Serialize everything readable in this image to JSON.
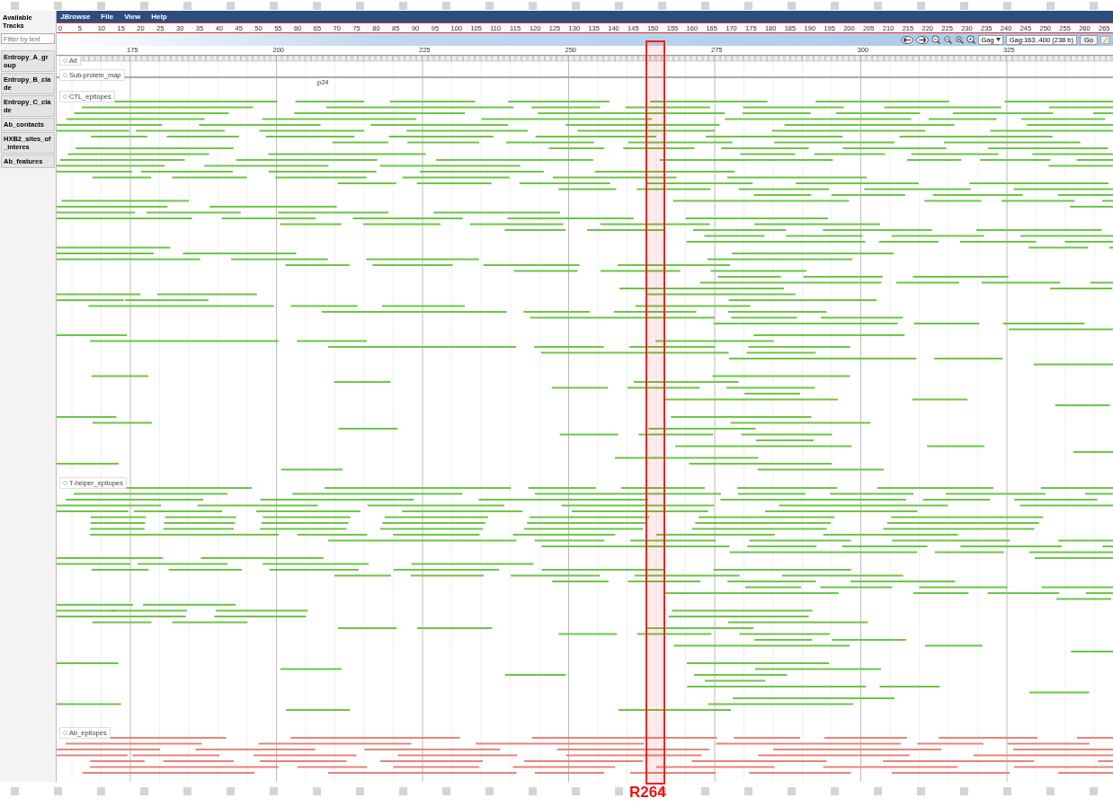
{
  "sidebar": {
    "title": "Available Tracks",
    "filter": {
      "placeholder": "Filter by text"
    },
    "tracks": [
      "Entropy_A_group",
      "Entropy_B_clade",
      "Entropy_C_clade",
      "Ab_contacts",
      "HXB2_sites_of_interes",
      "Ab_features"
    ]
  },
  "menu": {
    "logo": "JBrowse",
    "items": [
      "File",
      "View",
      "Help"
    ]
  },
  "overview_ruler": {
    "ticks": [
      "0",
      "5",
      "10",
      "15",
      "20",
      "25",
      "30",
      "35",
      "40",
      "45",
      "50",
      "55",
      "60",
      "65",
      "70",
      "75",
      "80",
      "85",
      "90",
      "95",
      "100",
      "105",
      "110",
      "115",
      "120",
      "125",
      "130",
      "135",
      "140",
      "145",
      "150",
      "155",
      "160",
      "165",
      "170",
      "175",
      "180",
      "185",
      "190",
      "195",
      "200",
      "205",
      "210",
      "215",
      "220",
      "225",
      "230",
      "235",
      "240",
      "245",
      "250",
      "255",
      "260",
      "265"
    ]
  },
  "navigation": {
    "reference": "Gag",
    "location": "Gag:163..400 (238 b)",
    "go": "Go"
  },
  "detail_ruler": {
    "ticks": [
      "175",
      "200",
      "225",
      "250",
      "275",
      "300",
      "325"
    ]
  },
  "tracks": [
    {
      "label": "Alt",
      "kind": "sequence"
    },
    {
      "label": "Sub-protein_map",
      "kind": "map",
      "features": [
        "p24"
      ]
    },
    {
      "label": "CTL_epitopes",
      "kind": "features",
      "color": "#6cc644"
    },
    {
      "label": "T-helper_epitopes",
      "kind": "features",
      "color": "#6cc644"
    },
    {
      "label": "Ab_epitopes",
      "kind": "features",
      "color": "#e8837a"
    }
  ],
  "highlight": {
    "label": "R264"
  }
}
